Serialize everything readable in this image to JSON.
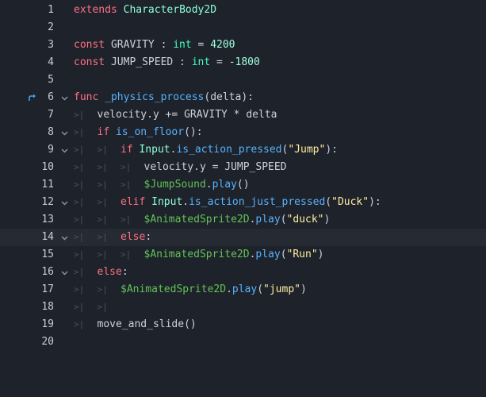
{
  "editor": {
    "lines": [
      {
        "num": "1",
        "tokens": [
          [
            "kw",
            "extends"
          ],
          [
            "plain",
            " "
          ],
          [
            "cls",
            "CharacterBody2D"
          ]
        ]
      },
      {
        "num": "2",
        "tokens": []
      },
      {
        "num": "3",
        "tokens": [
          [
            "kw",
            "const"
          ],
          [
            "plain",
            " GRAVITY : "
          ],
          [
            "ty",
            "int"
          ],
          [
            "plain",
            " = "
          ],
          [
            "num",
            "4200"
          ]
        ]
      },
      {
        "num": "4",
        "tokens": [
          [
            "kw",
            "const"
          ],
          [
            "plain",
            " JUMP_SPEED : "
          ],
          [
            "ty",
            "int"
          ],
          [
            "plain",
            " = "
          ],
          [
            "num",
            "-1800"
          ]
        ]
      },
      {
        "num": "5",
        "tokens": []
      },
      {
        "num": "6",
        "tokens": [
          [
            "kw",
            "func"
          ],
          [
            "plain",
            " "
          ],
          [
            "fn",
            "_physics_process"
          ],
          [
            "plain",
            "(delta):"
          ]
        ]
      },
      {
        "num": "7",
        "indent": 1,
        "tokens": [
          [
            "plain",
            "velocity.y += GRAVITY * delta"
          ]
        ]
      },
      {
        "num": "8",
        "indent": 1,
        "tokens": [
          [
            "kw",
            "if"
          ],
          [
            "plain",
            " "
          ],
          [
            "fn",
            "is_on_floor"
          ],
          [
            "plain",
            "():"
          ]
        ]
      },
      {
        "num": "9",
        "indent": 2,
        "tokens": [
          [
            "kw",
            "if"
          ],
          [
            "plain",
            " "
          ],
          [
            "cls",
            "Input"
          ],
          [
            "plain",
            "."
          ],
          [
            "fn",
            "is_action_pressed"
          ],
          [
            "plain",
            "("
          ],
          [
            "str",
            "\"Jump\""
          ],
          [
            "plain",
            "):"
          ]
        ]
      },
      {
        "num": "10",
        "indent": 3,
        "tokens": [
          [
            "plain",
            "velocity.y = JUMP_SPEED"
          ]
        ]
      },
      {
        "num": "11",
        "indent": 3,
        "tokens": [
          [
            "node",
            "$JumpSound"
          ],
          [
            "plain",
            "."
          ],
          [
            "fn",
            "play"
          ],
          [
            "plain",
            "()"
          ]
        ]
      },
      {
        "num": "12",
        "indent": 2,
        "tokens": [
          [
            "kw",
            "elif"
          ],
          [
            "plain",
            " "
          ],
          [
            "cls",
            "Input"
          ],
          [
            "plain",
            "."
          ],
          [
            "fn",
            "is_action_just_pressed"
          ],
          [
            "plain",
            "("
          ],
          [
            "str",
            "\"Duck\""
          ],
          [
            "plain",
            "):"
          ]
        ]
      },
      {
        "num": "13",
        "indent": 3,
        "tokens": [
          [
            "node",
            "$AnimatedSprite2D"
          ],
          [
            "plain",
            "."
          ],
          [
            "fn",
            "play"
          ],
          [
            "plain",
            "("
          ],
          [
            "str",
            "\"duck\""
          ],
          [
            "plain",
            ")"
          ]
        ]
      },
      {
        "num": "14",
        "indent": 2,
        "tokens": [
          [
            "kw",
            "else"
          ],
          [
            "plain",
            ":"
          ]
        ]
      },
      {
        "num": "15",
        "indent": 3,
        "tokens": [
          [
            "node",
            "$AnimatedSprite2D"
          ],
          [
            "plain",
            "."
          ],
          [
            "fn",
            "play"
          ],
          [
            "plain",
            "("
          ],
          [
            "str",
            "\"Run\""
          ],
          [
            "plain",
            ")"
          ]
        ]
      },
      {
        "num": "16",
        "indent": 1,
        "tokens": [
          [
            "kw",
            "else"
          ],
          [
            "plain",
            ":"
          ]
        ]
      },
      {
        "num": "17",
        "indent": 2,
        "tokens": [
          [
            "node",
            "$AnimatedSprite2D"
          ],
          [
            "plain",
            "."
          ],
          [
            "fn",
            "play"
          ],
          [
            "plain",
            "("
          ],
          [
            "str",
            "\"jump\""
          ],
          [
            "plain",
            ")"
          ]
        ]
      },
      {
        "num": "18",
        "indent": 2,
        "tokens": []
      },
      {
        "num": "19",
        "indent": 1,
        "tokens": [
          [
            "plain",
            "move_and_slide()"
          ]
        ]
      },
      {
        "num": "20",
        "tokens": []
      }
    ],
    "fold_lines": [
      "6",
      "8",
      "9",
      "12",
      "14",
      "16"
    ],
    "current_line": "14",
    "override_marker_line": "6",
    "override_icon": "override-arrow-icon",
    "fold_icon": "chevron-down-icon",
    "indent_glyph": ">|",
    "colors": {
      "background": "#1e222a",
      "keyword": "#ff7085",
      "type": "#42ffc2",
      "number": "#a1ffe0",
      "function": "#57b3ff",
      "string": "#ffeda1",
      "node_path": "#63c259"
    }
  }
}
